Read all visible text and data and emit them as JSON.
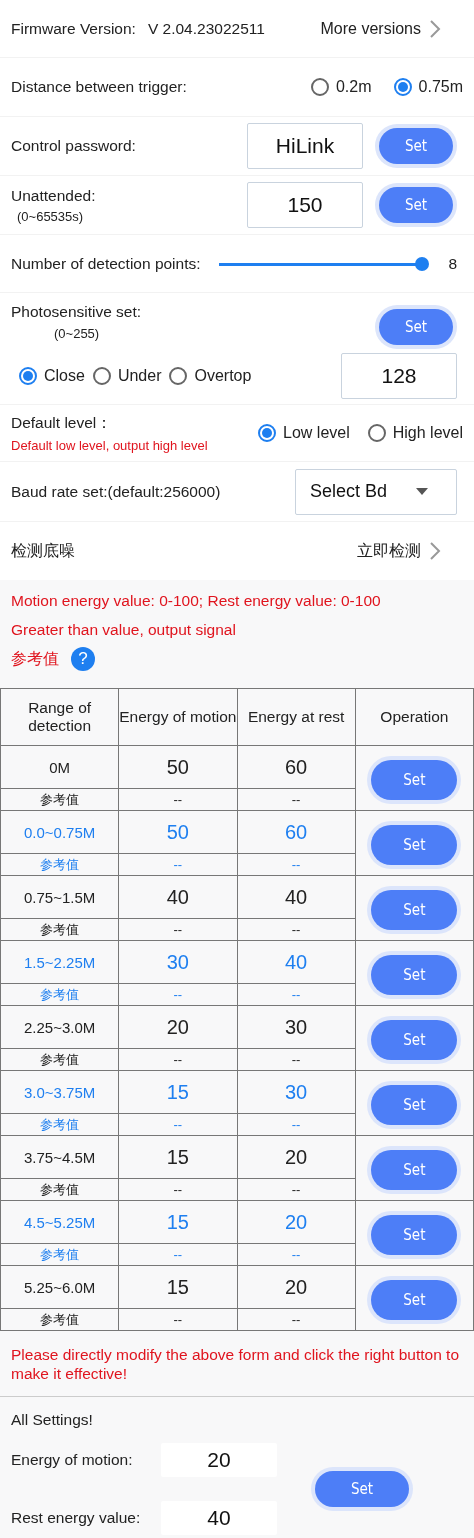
{
  "firmware": {
    "label": "Firmware Version:",
    "version": "V 2.04.23022511",
    "link": "More versions"
  },
  "distance": {
    "label": "Distance between trigger:",
    "options": [
      {
        "label": "0.2m",
        "selected": false
      },
      {
        "label": "0.75m",
        "selected": true
      }
    ]
  },
  "password": {
    "label": "Control password:",
    "value": "HiLink",
    "button": "Set"
  },
  "unattended": {
    "label": "Unattended:",
    "hint": "(0~65535s)",
    "value": "150",
    "button": "Set"
  },
  "detection_points": {
    "label": "Number of detection points:",
    "level": 1.0,
    "reading": "8"
  },
  "photosensitive": {
    "label": "Photosensitive set:",
    "hint": "(0~255)",
    "button": "Set",
    "options": [
      {
        "label": "Close",
        "selected": true
      },
      {
        "label": "Under",
        "selected": false
      },
      {
        "label": "Overtop",
        "selected": false
      }
    ],
    "value": "128"
  },
  "default_level": {
    "label": "Default level：",
    "note": "Default low level, output high level",
    "options": [
      {
        "label": "Low level",
        "selected": true
      },
      {
        "label": "High level",
        "selected": false
      }
    ]
  },
  "baud_rate": {
    "label": "Baud rate set:(default:256000)",
    "value": "Select Bd"
  },
  "noise": {
    "label": "检测底噪",
    "link": "立即检测"
  },
  "notes": [
    "Motion energy value: 0-100; Rest energy value: 0-100",
    "Greater than value, output signal"
  ],
  "reference": {
    "label": "参考值",
    "help": "?"
  },
  "table": {
    "columns": [
      "Range of detection",
      "Energy of motion",
      "Energy at rest",
      "Operation"
    ],
    "rows": [
      {
        "range": "0M",
        "motion": "50",
        "rest": "60",
        "ref_label": "参考值",
        "ref_motion": "--",
        "ref_rest": "--",
        "button": "Set",
        "highlighted": false
      },
      {
        "range": "0.0~0.75M",
        "motion": "50",
        "rest": "60",
        "ref_label": "参考值",
        "ref_motion": "--",
        "ref_rest": "--",
        "button": "Set",
        "highlighted": true
      },
      {
        "range": "0.75~1.5M",
        "motion": "40",
        "rest": "40",
        "ref_label": "参考值",
        "ref_motion": "--",
        "ref_rest": "--",
        "button": "Set",
        "highlighted": false
      },
      {
        "range": "1.5~2.25M",
        "motion": "30",
        "rest": "40",
        "ref_label": "参考值",
        "ref_motion": "--",
        "ref_rest": "--",
        "button": "Set",
        "highlighted": true
      },
      {
        "range": "2.25~3.0M",
        "motion": "20",
        "rest": "30",
        "ref_label": "参考值",
        "ref_motion": "--",
        "ref_rest": "--",
        "button": "Set",
        "highlighted": false
      },
      {
        "range": "3.0~3.75M",
        "motion": "15",
        "rest": "30",
        "ref_label": "参考值",
        "ref_motion": "--",
        "ref_rest": "--",
        "button": "Set",
        "highlighted": true
      },
      {
        "range": "3.75~4.5M",
        "motion": "15",
        "rest": "20",
        "ref_label": "参考值",
        "ref_motion": "--",
        "ref_rest": "--",
        "button": "Set",
        "highlighted": false
      },
      {
        "range": "4.5~5.25M",
        "motion": "15",
        "rest": "20",
        "ref_label": "参考值",
        "ref_motion": "--",
        "ref_rest": "--",
        "button": "Set",
        "highlighted": true
      },
      {
        "range": "5.25~6.0M",
        "motion": "15",
        "rest": "20",
        "ref_label": "参考值",
        "ref_motion": "--",
        "ref_rest": "--",
        "button": "Set",
        "highlighted": false
      }
    ]
  },
  "table_note": "Please directly modify the above form and click the right button to make it effective!",
  "all_settings": {
    "title": "All Settings!",
    "motion_label": "Energy of motion:",
    "motion_value": "20",
    "rest_label": "Rest energy value:",
    "rest_value": "40",
    "button": "Set"
  }
}
